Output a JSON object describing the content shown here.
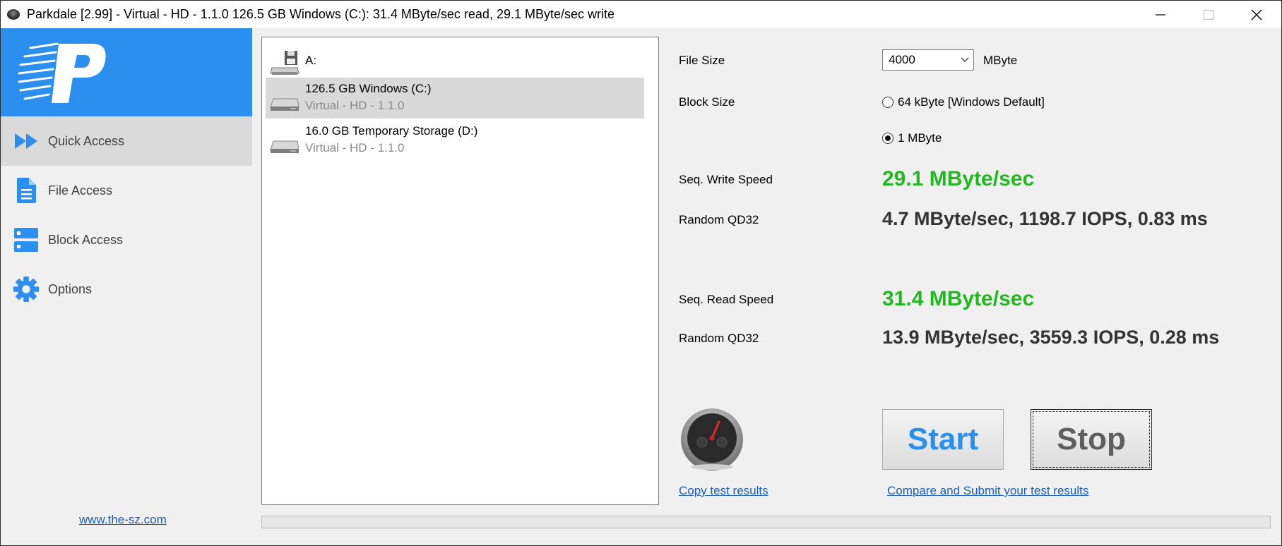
{
  "window": {
    "title": "Parkdale [2.99] - Virtual - HD - 1.1.0 126.5 GB Windows (C:): 31.4 MByte/sec read, 29.1 MByte/sec write",
    "controls": [
      "minimize-icon",
      "maximize-icon",
      "close-icon"
    ]
  },
  "sidebar": {
    "logo_icon": "parkdale-p-logo",
    "items": [
      {
        "label": "Quick Access",
        "icon": "fast-forward-icon",
        "active": true
      },
      {
        "label": "File Access",
        "icon": "document-icon",
        "active": false
      },
      {
        "label": "Block Access",
        "icon": "server-blocks-icon",
        "active": false
      },
      {
        "label": "Options",
        "icon": "gear-icon",
        "active": false
      }
    ],
    "website": "www.the-sz.com"
  },
  "drives": [
    {
      "name": "A:",
      "sub": "",
      "icon": "floppy-drive-icon",
      "selected": false
    },
    {
      "name": "126.5 GB Windows (C:)",
      "sub": "Virtual - HD - 1.1.0",
      "icon": "hard-drive-icon",
      "selected": true
    },
    {
      "name": "16.0 GB Temporary Storage (D:)",
      "sub": "Virtual - HD - 1.1.0",
      "icon": "hard-drive-icon",
      "selected": false
    }
  ],
  "settings": {
    "file_size_label": "File Size",
    "file_size_value": "4000",
    "file_size_unit": "MByte",
    "block_size_label": "Block Size",
    "block_options": [
      {
        "label": "64 kByte [Windows Default]",
        "checked": false
      },
      {
        "label": "1 MByte",
        "checked": true
      }
    ]
  },
  "results": {
    "write_label": "Seq. Write Speed",
    "write_value": "29.1 MByte/sec",
    "write_random_label": "Random QD32",
    "write_random_value": "4.7 MByte/sec, 1198.7 IOPS, 0.83 ms",
    "read_label": "Seq. Read Speed",
    "read_value": "31.4 MByte/sec",
    "read_random_label": "Random QD32",
    "read_random_value": "13.9 MByte/sec, 3559.3 IOPS, 0.28 ms"
  },
  "actions": {
    "gauge_icon": "speedometer-icon",
    "copy_link": "Copy test results",
    "compare_link": "Compare and Submit your test results",
    "start_label": "Start",
    "stop_label": "Stop"
  },
  "progress": {
    "value": 0
  },
  "colors": {
    "accent": "#2b8fef",
    "speed_green": "#22b81f",
    "link": "#1a5fb4"
  }
}
